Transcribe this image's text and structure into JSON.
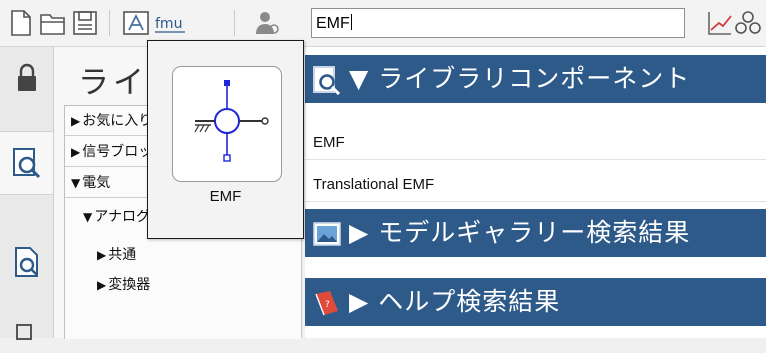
{
  "toolbar": {
    "icons": [
      "new-file-icon",
      "open-folder-icon",
      "save-icon",
      "library-browser-icon",
      "fmu-icon",
      "user-settings-icon",
      "plot-icon",
      "components-icon"
    ],
    "fmu_label": "fmu",
    "search": {
      "value": "EMF"
    }
  },
  "rail": {
    "tabs": [
      "lock-icon",
      "library-search-icon",
      "document-search-icon",
      "misc-icon"
    ]
  },
  "library_panel": {
    "title": "ライブラリ",
    "tree": [
      {
        "label": "お気に入り",
        "state": "collapsed"
      },
      {
        "label": "信号ブロック",
        "state": "collapsed"
      },
      {
        "label": "電気",
        "state": "expanded"
      },
      {
        "label": "アナログ",
        "state": "expanded"
      },
      {
        "label": "共通",
        "state": "collapsed"
      },
      {
        "label": "変換器",
        "state": "collapsed"
      }
    ]
  },
  "popup": {
    "label": "EMF"
  },
  "results": {
    "library_header": "ライブラリコンポーネント",
    "items": [
      "EMF",
      "Translational EMF"
    ],
    "model_gallery_header": "モデルギャラリー検索結果",
    "help_header": "ヘルプ検索結果"
  },
  "colors": {
    "header_band": "#2e5a8a",
    "emf_blue": "#1d27d8"
  }
}
